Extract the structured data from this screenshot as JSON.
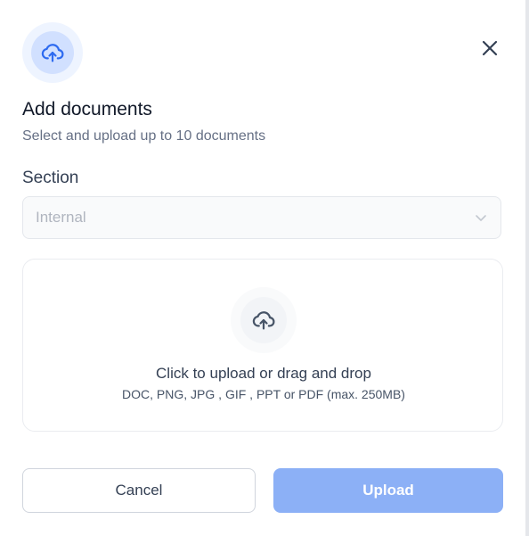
{
  "dialog": {
    "title": "Add documents",
    "subtitle": "Select and upload up to 10 documents",
    "header_icon": "cloud-upload-icon",
    "close_icon": "close-icon"
  },
  "section": {
    "label": "Section",
    "selected_value": "Internal",
    "chevron_icon": "chevron-down-icon"
  },
  "dropzone": {
    "icon": "cloud-upload-icon",
    "primary_text": "Click to upload or drag and drop",
    "secondary_text": "DOC, PNG, JPG , GIF , PPT or PDF (max. 250MB)"
  },
  "actions": {
    "cancel_label": "Cancel",
    "upload_label": "Upload"
  },
  "colors": {
    "accent": "#2e6bf0",
    "upload_button_disabled": "#8cb0f6",
    "title_text": "#101828",
    "muted_text": "#667085"
  }
}
